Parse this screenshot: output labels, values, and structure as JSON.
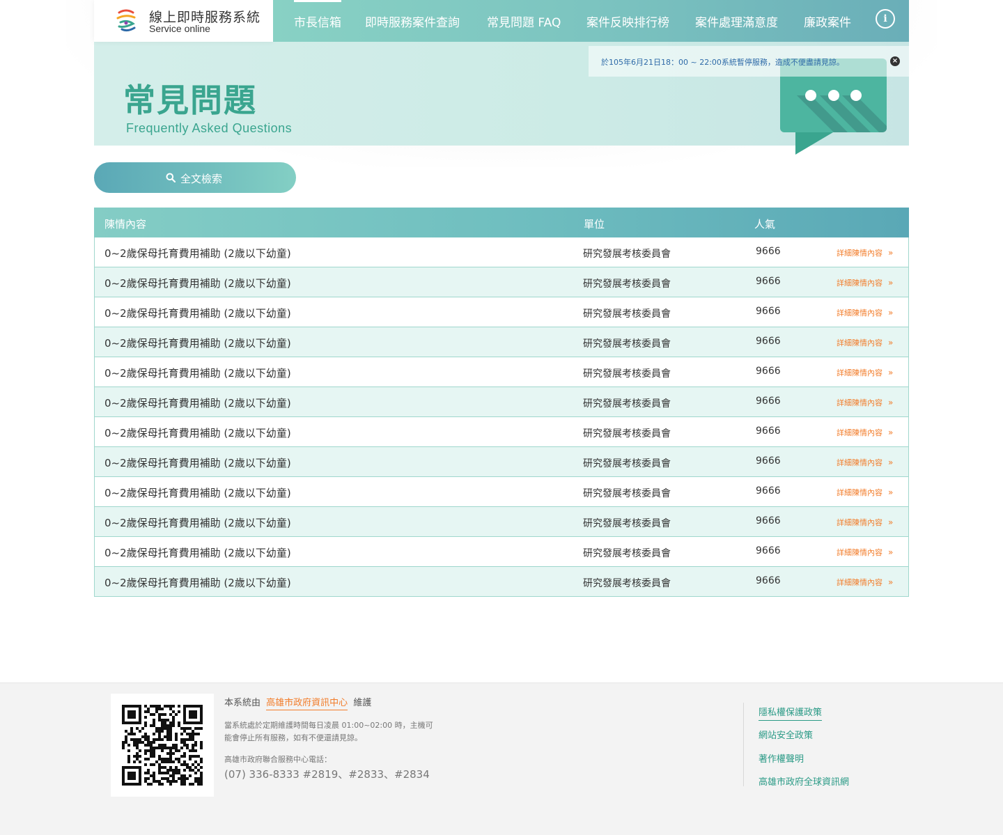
{
  "header": {
    "logo_title": "線上即時服務系統",
    "logo_subtitle": "Service online",
    "nav": [
      {
        "label": "市長信箱"
      },
      {
        "label": "即時服務案件查詢"
      },
      {
        "label": "常見問題 FAQ"
      },
      {
        "label": "案件反映排行榜"
      },
      {
        "label": "案件處理滿意度"
      },
      {
        "label": "廉政案件"
      }
    ],
    "info_icon": "i"
  },
  "notice": {
    "text": "於105年6月21日18：00 ~ 22:00系統暫停服務，造成不便盡請見諒。",
    "close_icon": "×"
  },
  "hero": {
    "title": "常見問題",
    "subtitle": "Frequently Asked Questions"
  },
  "search": {
    "label": "全文檢索"
  },
  "table": {
    "headers": {
      "content": "陳情內容",
      "unit": "單位",
      "popularity": "人氣"
    },
    "more_label": "詳細陳情內容",
    "more_icon": "»",
    "rows": [
      {
        "title": "0~2歲保母托育費用補助 (2歲以下幼童)",
        "unit": "研究發展考核委員會",
        "popularity": "9666"
      },
      {
        "title": "0~2歲保母托育費用補助 (2歲以下幼童)",
        "unit": "研究發展考核委員會",
        "popularity": "9666"
      },
      {
        "title": "0~2歲保母托育費用補助 (2歲以下幼童)",
        "unit": "研究發展考核委員會",
        "popularity": "9666"
      },
      {
        "title": "0~2歲保母托育費用補助 (2歲以下幼童)",
        "unit": "研究發展考核委員會",
        "popularity": "9666"
      },
      {
        "title": "0~2歲保母托育費用補助 (2歲以下幼童)",
        "unit": "研究發展考核委員會",
        "popularity": "9666"
      },
      {
        "title": "0~2歲保母托育費用補助 (2歲以下幼童)",
        "unit": "研究發展考核委員會",
        "popularity": "9666"
      },
      {
        "title": "0~2歲保母托育費用補助 (2歲以下幼童)",
        "unit": "研究發展考核委員會",
        "popularity": "9666"
      },
      {
        "title": "0~2歲保母托育費用補助 (2歲以下幼童)",
        "unit": "研究發展考核委員會",
        "popularity": "9666"
      },
      {
        "title": "0~2歲保母托育費用補助 (2歲以下幼童)",
        "unit": "研究發展考核委員會",
        "popularity": "9666"
      },
      {
        "title": "0~2歲保母托育費用補助 (2歲以下幼童)",
        "unit": "研究發展考核委員會",
        "popularity": "9666"
      },
      {
        "title": "0~2歲保母托育費用補助 (2歲以下幼童)",
        "unit": "研究發展考核委員會",
        "popularity": "9666"
      },
      {
        "title": "0~2歲保母托育費用補助 (2歲以下幼童)",
        "unit": "研究發展考核委員會",
        "popularity": "9666"
      }
    ]
  },
  "footer": {
    "maint_prefix": "本系統由",
    "maint_link": "高雄市政府資訊中心",
    "maint_suffix": "維護",
    "note": "當系統處於定期維護時間每日凌晨 01:00~02:00 時，主機可能會停止所有服務，如有不便還請見諒。",
    "phone_label": "高雄市政府聯合服務中心電話：",
    "phone": "(07) 336-8333 #2819、#2833、#2834",
    "links": [
      {
        "label": "隱私權保護政策"
      },
      {
        "label": "網站安全政策"
      },
      {
        "label": "著作權聲明"
      },
      {
        "label": "高雄市政府全球資訊網"
      }
    ]
  },
  "colors": {
    "brand_teal": "#3aa58f",
    "accent_orange": "#f27c2a",
    "notice_blue": "#2e6aa8"
  }
}
